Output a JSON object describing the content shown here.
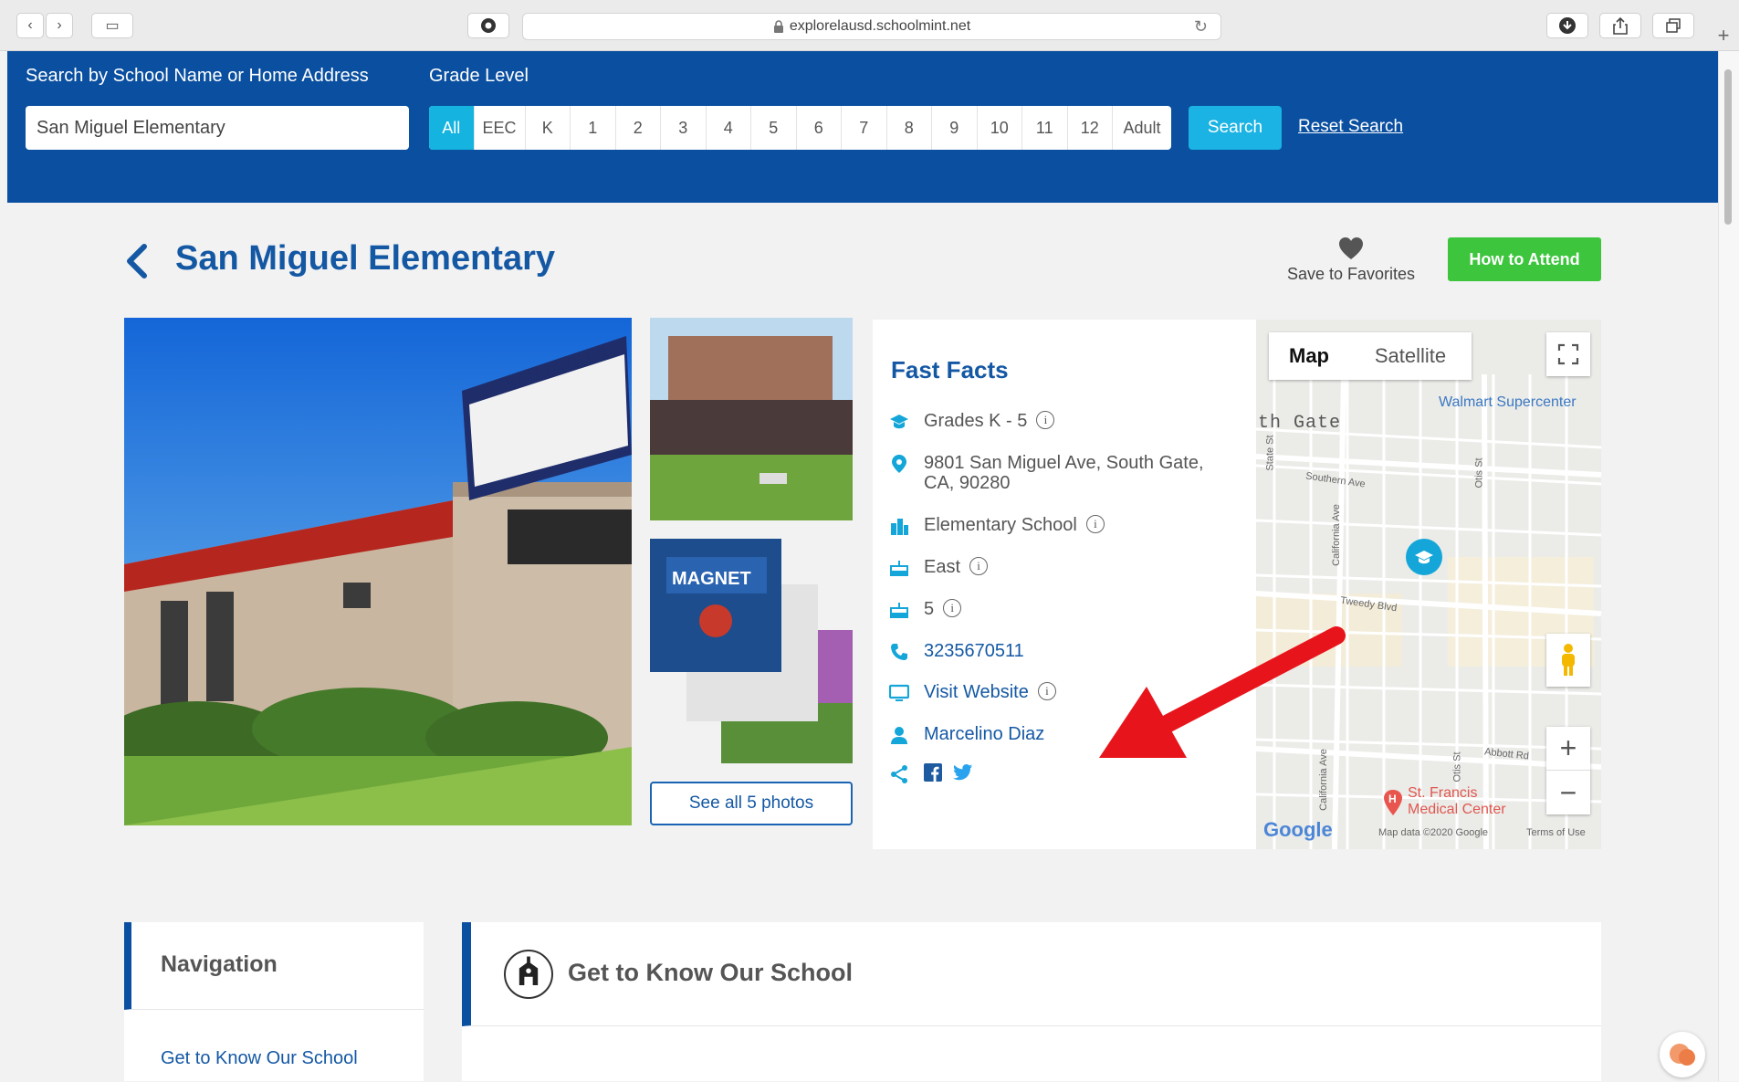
{
  "browser": {
    "url": "explorelausd.schoolmint.net",
    "back_glyph": "‹",
    "forward_glyph": "›",
    "sidebar_glyph": "▭",
    "add_tab_glyph": "+"
  },
  "search": {
    "label": "Search by School Name or Home Address",
    "value": "San Miguel Elementary",
    "grade_label": "Grade Level",
    "grades": [
      "All",
      "EEC",
      "K",
      "1",
      "2",
      "3",
      "4",
      "5",
      "6",
      "7",
      "8",
      "9",
      "10",
      "11",
      "12",
      "Adult"
    ],
    "selected_grade": "All",
    "search_button": "Search",
    "reset_link": "Reset Search"
  },
  "school": {
    "name": "San Miguel Elementary",
    "save_label": "Save to Favorites",
    "attend_button": "How to Attend",
    "see_all_photos": "See all 5 photos"
  },
  "fast_facts": {
    "title": "Fast Facts",
    "grades": "Grades K - 5",
    "address_line1": "9801 San Miguel Ave, South Gate,",
    "address_line2": "CA, 90280",
    "type": "Elementary School",
    "region": "East",
    "board_district": "5",
    "phone": "3235670511",
    "website": "Visit Website",
    "principal": "Marcelino Diaz",
    "info_glyph": "i"
  },
  "map": {
    "tab_map": "Map",
    "tab_satellite": "Satellite",
    "labels": {
      "walmart": "Walmart Supercenter",
      "city": "th Gate",
      "southern": "Southern Ave",
      "tweedy": "Tweedy Blvd",
      "abbott": "Abbott Rd",
      "state": "State St",
      "otis": "Otis St",
      "california": "California Ave",
      "california2": "California Ave",
      "otis2": "Otis St",
      "stfrancis1": "St. Francis",
      "stfrancis2": "Medical Center",
      "google": "Google",
      "mapdata": "Map data ©2020 Google",
      "terms": "Terms of Use"
    },
    "zoom_in": "+",
    "zoom_out": "−"
  },
  "navigation": {
    "title": "Navigation",
    "items": [
      "Get to Know Our School"
    ]
  },
  "section": {
    "title": "Get to Know Our School"
  },
  "colors": {
    "brand_blue": "#0a4fa0",
    "accent_cyan": "#14b3e0",
    "green": "#3dc53d",
    "link_blue": "#1458a4",
    "annotation_red": "#e8141b"
  }
}
